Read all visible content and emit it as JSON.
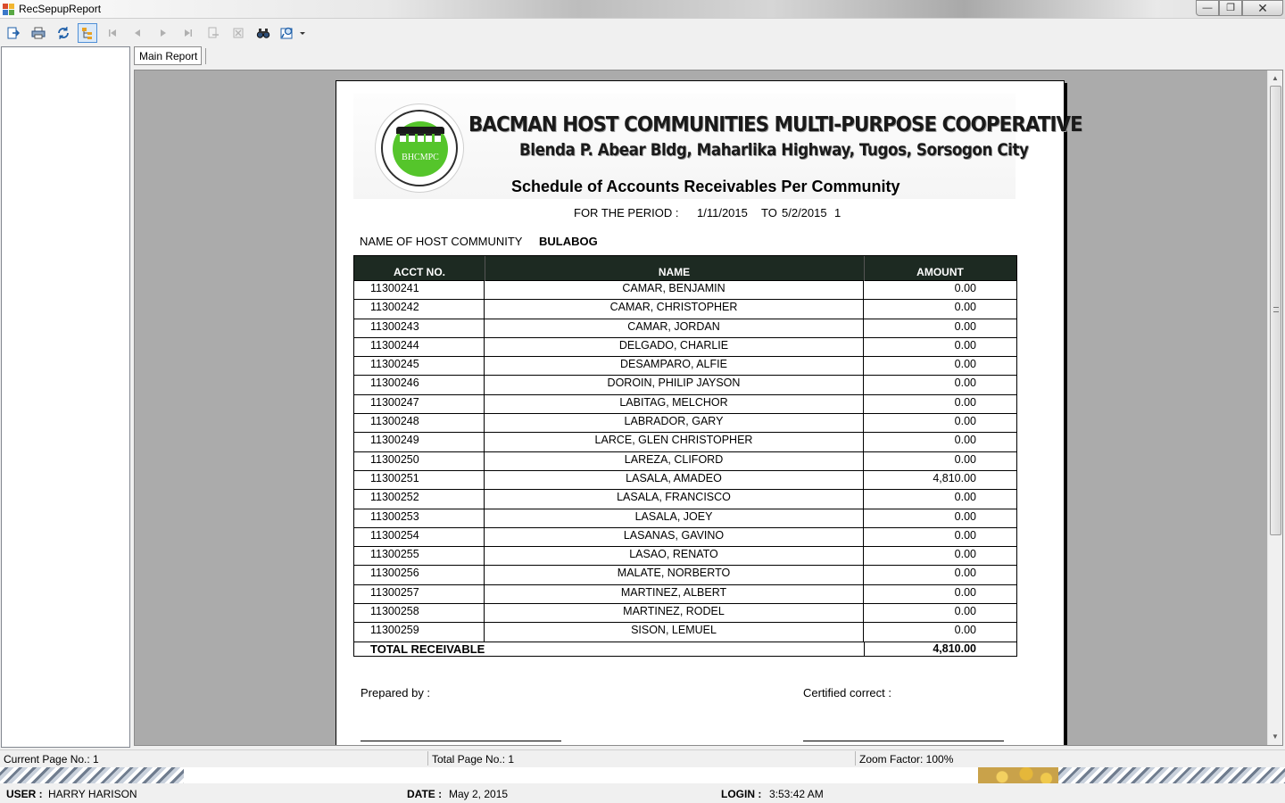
{
  "window": {
    "title": "RecSepupReport",
    "min_label": "—",
    "max_label": "❐",
    "close_label": "✕"
  },
  "toolbar": {
    "buttons": [
      "export",
      "print",
      "refresh",
      "toggle-group-tree",
      "first-page",
      "previous-page",
      "next-page",
      "last-page",
      "go-to-page",
      "stop",
      "find",
      "zoom"
    ]
  },
  "tabs": [
    {
      "label": "Main Report"
    }
  ],
  "report": {
    "cooperative_name": "BACMAN HOST COMMUNITIES MULTI-PURPOSE COOPERATIVE",
    "address": "Blenda P. Abear Bldg, Maharlika Highway, Tugos, Sorsogon City",
    "logo_text": "BHCMPC",
    "title": "Schedule of Accounts Receivables  Per Community",
    "period_label": "FOR THE PERIOD :",
    "period_from": "1/11/2015",
    "period_to_label": "TO",
    "period_to": "5/2/2015",
    "period_suffix": "1",
    "host_label": "NAME OF HOST COMMUNITY",
    "host_value": "BULABOG",
    "columns": [
      "ACCT NO.",
      "NAME",
      "AMOUNT"
    ],
    "rows": [
      {
        "acct": "11300241",
        "name": "CAMAR, BENJAMIN",
        "amount": "0.00"
      },
      {
        "acct": "11300242",
        "name": "CAMAR, CHRISTOPHER",
        "amount": "0.00"
      },
      {
        "acct": "11300243",
        "name": "CAMAR, JORDAN",
        "amount": "0.00"
      },
      {
        "acct": "11300244",
        "name": "DELGADO, CHARLIE",
        "amount": "0.00"
      },
      {
        "acct": "11300245",
        "name": "DESAMPARO, ALFIE",
        "amount": "0.00"
      },
      {
        "acct": "11300246",
        "name": "DOROIN, PHILIP JAYSON",
        "amount": "0.00"
      },
      {
        "acct": "11300247",
        "name": "LABITAG, MELCHOR",
        "amount": "0.00"
      },
      {
        "acct": "11300248",
        "name": "LABRADOR, GARY",
        "amount": "0.00"
      },
      {
        "acct": "11300249",
        "name": "LARCE, GLEN CHRISTOPHER",
        "amount": "0.00"
      },
      {
        "acct": "11300250",
        "name": "LAREZA, CLIFORD",
        "amount": "0.00"
      },
      {
        "acct": "11300251",
        "name": "LASALA, AMADEO",
        "amount": "4,810.00"
      },
      {
        "acct": "11300252",
        "name": "LASALA, FRANCISCO",
        "amount": "0.00"
      },
      {
        "acct": "11300253",
        "name": "LASALA, JOEY",
        "amount": "0.00"
      },
      {
        "acct": "11300254",
        "name": "LASANAS, GAVINO",
        "amount": "0.00"
      },
      {
        "acct": "11300255",
        "name": "LASAO, RENATO",
        "amount": "0.00"
      },
      {
        "acct": "11300256",
        "name": "MALATE, NORBERTO",
        "amount": "0.00"
      },
      {
        "acct": "11300257",
        "name": "MARTINEZ, ALBERT",
        "amount": "0.00"
      },
      {
        "acct": "11300258",
        "name": "MARTINEZ, RODEL",
        "amount": "0.00"
      },
      {
        "acct": "11300259",
        "name": "SISON, LEMUEL",
        "amount": "0.00"
      }
    ],
    "total_label": "TOTAL RECEIVABLE",
    "total_value": "4,810.00",
    "prepared_label": "Prepared by :",
    "certified_label": "Certified correct :"
  },
  "status": {
    "current_page": "Current Page No.: 1",
    "total_page": "Total Page No.: 1",
    "zoom": "Zoom Factor: 100%"
  },
  "footer": {
    "user_label": "USER :",
    "user_value": "HARRY HARISON",
    "date_label": "DATE :",
    "date_value": "May 2, 2015",
    "login_label": "LOGIN :",
    "login_value": "3:53:42 AM"
  }
}
